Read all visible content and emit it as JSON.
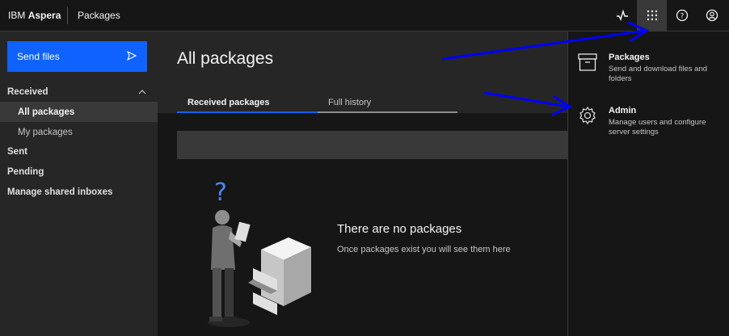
{
  "header": {
    "brand_prefix": "IBM",
    "brand_name": "Aspera",
    "app_name": "Packages",
    "icons": [
      "activity-icon",
      "app-switcher-icon",
      "help-icon",
      "user-avatar-icon"
    ]
  },
  "sidebar": {
    "send_button": "Send files",
    "items": [
      {
        "label": "Received",
        "level": "top"
      },
      {
        "label": "All packages",
        "level": "sub",
        "selected": true
      },
      {
        "label": "My packages",
        "level": "sub"
      },
      {
        "label": "Sent",
        "level": "top"
      },
      {
        "label": "Pending",
        "level": "top"
      },
      {
        "label": "Manage shared inboxes",
        "level": "top"
      }
    ]
  },
  "main": {
    "title": "All packages",
    "tabs": [
      {
        "label": "Received packages",
        "selected": true
      },
      {
        "label": "Full history",
        "selected": false
      }
    ],
    "empty_title": "There are no packages",
    "empty_subtitle": "Once packages exist you will see them here",
    "illustration_symbol": "?"
  },
  "switcher": {
    "items": [
      {
        "title": "Packages",
        "description": "Send and download files and folders",
        "icon": "package-box-icon"
      },
      {
        "title": "Admin",
        "description": "Manage users and configure server settings",
        "icon": "settings-gear-icon"
      }
    ]
  },
  "colors": {
    "accent": "#0f62fe",
    "background": "#161616",
    "sidebar": "#262626",
    "annotation_arrow": "#0000ff"
  }
}
